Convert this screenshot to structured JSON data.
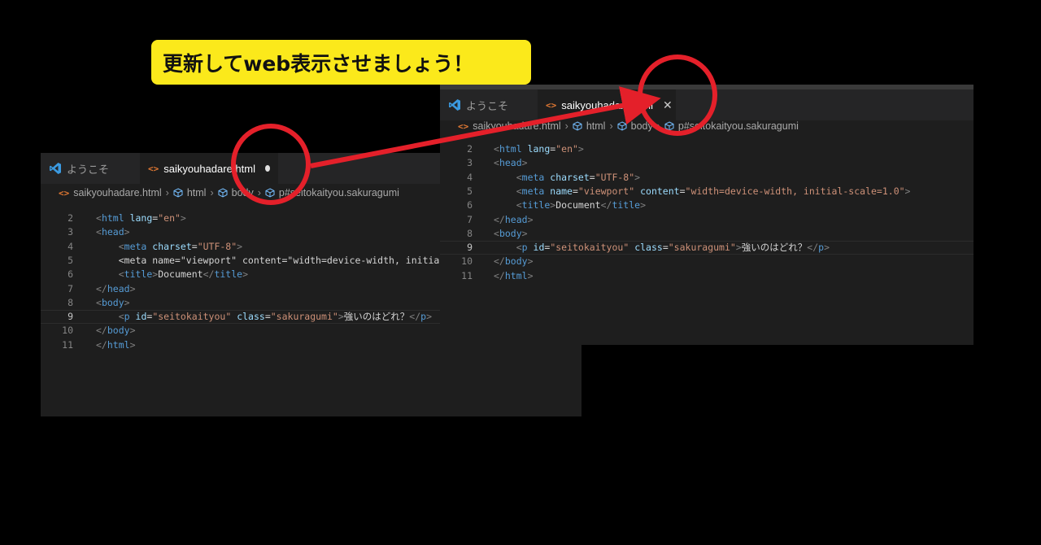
{
  "callout": {
    "text": "更新してweb表示させましょう！"
  },
  "colors": {
    "callout_bg": "#fbe91b",
    "annotation_red": "#e4202a",
    "editor_bg": "#1e1e1e",
    "tag": "#569cd6",
    "attr": "#9cdcfe",
    "string": "#ce9178"
  },
  "before_editor": {
    "tabs": [
      {
        "icon": "vscode-icon",
        "label": "ようこそ"
      },
      {
        "icon": "html-file-icon",
        "label": "saikyouhadare.html",
        "status": "unsaved-dot"
      }
    ],
    "breadcrumbs": [
      "saikyouhadare.html",
      "html",
      "body",
      "p#seitokaityou.sakuragumi"
    ],
    "lines": [
      {
        "n": "2",
        "text": "<html lang=\"en\">"
      },
      {
        "n": "3",
        "text": "<head>"
      },
      {
        "n": "4",
        "text": "    <meta charset=\"UTF-8\">"
      },
      {
        "n": "5",
        "text": "    <meta name=\"viewport\" content=\"width=device-width, initia"
      },
      {
        "n": "6",
        "text": "    <title>Document</title>"
      },
      {
        "n": "7",
        "text": "</head>"
      },
      {
        "n": "8",
        "text": "<body>"
      },
      {
        "n": "9",
        "text": "    <p id=\"seitokaityou\" class=\"sakuragumi\">強いのはどれ？</p>"
      },
      {
        "n": "10",
        "text": "</body>"
      },
      {
        "n": "11",
        "text": "</html>"
      }
    ]
  },
  "after_editor": {
    "tabs": [
      {
        "icon": "vscode-icon",
        "label": "ようこそ"
      },
      {
        "icon": "html-file-icon",
        "label": "saikyouhadare.html",
        "status": "close-icon"
      }
    ],
    "breadcrumbs": [
      "saikyouhadare.html",
      "html",
      "body",
      "p#seitokaityou.sakuragumi"
    ],
    "lines": [
      {
        "n": "2",
        "text": "<html lang=\"en\">"
      },
      {
        "n": "3",
        "text": "<head>"
      },
      {
        "n": "4",
        "text": "    <meta charset=\"UTF-8\">"
      },
      {
        "n": "5",
        "text": "    <meta name=\"viewport\" content=\"width=device-width, initial-scale=1.0\">"
      },
      {
        "n": "6",
        "text": "    <title>Document</title>"
      },
      {
        "n": "7",
        "text": "</head>"
      },
      {
        "n": "8",
        "text": "<body>"
      },
      {
        "n": "9",
        "text": "    <p id=\"seitokaityou\" class=\"sakuragumi\">強いのはどれ？</p>"
      },
      {
        "n": "10",
        "text": "</body>"
      },
      {
        "n": "11",
        "text": "</html>"
      }
    ],
    "current_line": "9"
  }
}
